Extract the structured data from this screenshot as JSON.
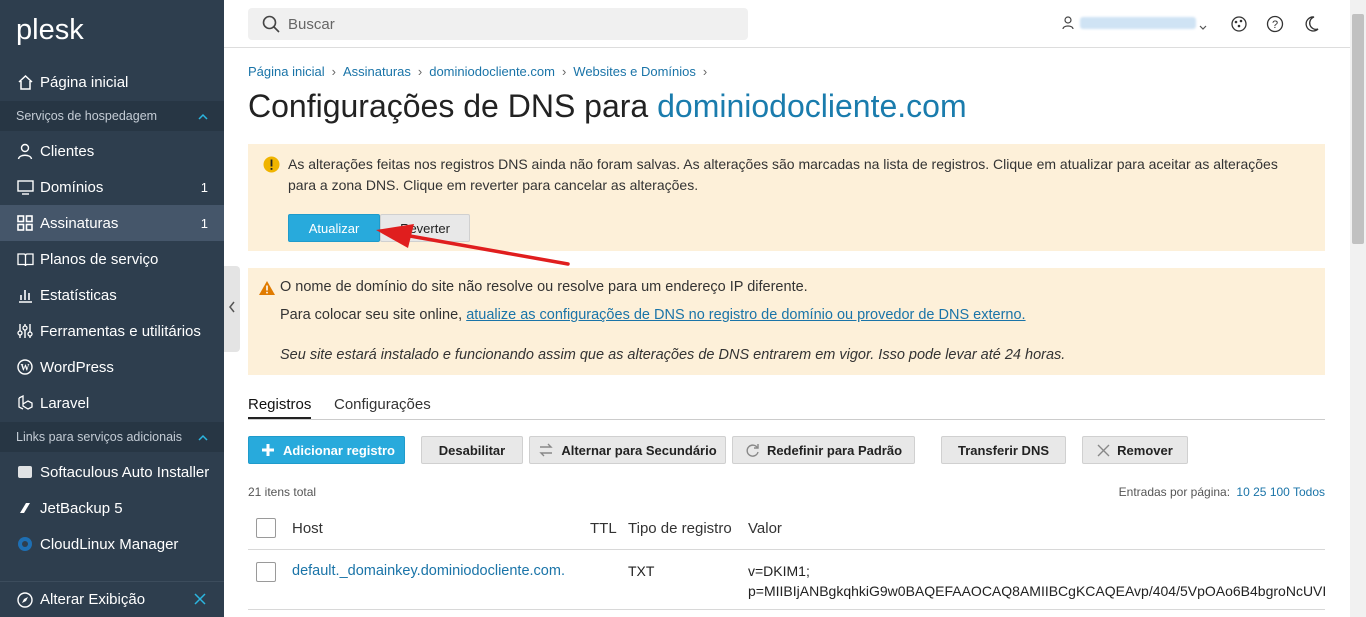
{
  "sidebar": {
    "logo": "plesk",
    "home": "Página inicial",
    "section1": "Serviços de hospedagem",
    "items": [
      {
        "label": "Clientes",
        "count": ""
      },
      {
        "label": "Domínios",
        "count": "1"
      },
      {
        "label": "Assinaturas",
        "count": "1"
      },
      {
        "label": "Planos de serviço",
        "count": ""
      },
      {
        "label": "Estatísticas",
        "count": ""
      },
      {
        "label": "Ferramentas e utilitários",
        "count": ""
      },
      {
        "label": "WordPress",
        "count": ""
      },
      {
        "label": "Laravel",
        "count": ""
      }
    ],
    "section2": "Links para serviços adicionais",
    "extra": [
      {
        "label": "Softaculous Auto Installer"
      },
      {
        "label": "JetBackup 5"
      },
      {
        "label": "CloudLinux Manager"
      }
    ],
    "footer": "Alterar Exibição"
  },
  "search": {
    "placeholder": "Buscar"
  },
  "breadcrumb": [
    "Página inicial",
    "Assinaturas",
    "dominiodocliente.com",
    "Websites e Domínios"
  ],
  "title": {
    "prefix": "Configurações de DNS para ",
    "domain": "dominiodocliente.com"
  },
  "notice1": {
    "text": "As alterações feitas nos registros DNS ainda não foram salvas. As alterações são marcadas na lista de registros. Clique em atualizar para aceitar as alterações para a zona DNS. Clique em reverter para cancelar as alterações.",
    "update_btn": "Atualizar",
    "revert_btn": "Reverter"
  },
  "notice2": {
    "line1": "O nome de domínio do site não resolve ou resolve para um endereço IP diferente.",
    "line2_prefix": "Para colocar seu site online, ",
    "line2_link": "atualize as configurações de DNS no registro de domínio ou provedor de DNS externo.",
    "line3": "Seu site estará instalado e funcionando assim que as alterações de DNS entrarem em vigor. Isso pode levar até 24 horas."
  },
  "tabs": [
    "Registros",
    "Configurações"
  ],
  "toolbar": {
    "add": "Adicionar registro",
    "disable": "Desabilitar",
    "secondary": "Alternar para Secundário",
    "reset": "Redefinir para Padrão",
    "transfer": "Transferir DNS",
    "remove": "Remover"
  },
  "list": {
    "total": "21 itens total",
    "per_page_label": "Entradas por página:",
    "per_page_options": [
      "10",
      "25",
      "100",
      "Todos"
    ]
  },
  "table": {
    "headers": [
      "Host",
      "TTL",
      "Tipo de registro",
      "Valor"
    ],
    "rows": [
      {
        "host": "default._domainkey.dominiodocliente.com.",
        "ttl": "",
        "type": "TXT",
        "value_line1": "v=DKIM1;",
        "value_line2": "p=MIIBIjANBgkqhkiG9w0BAQEFAAOCAQ8AMIIBCgKCAQEAvp/404/5VpOAo6B4bgroNcUVI"
      }
    ]
  }
}
